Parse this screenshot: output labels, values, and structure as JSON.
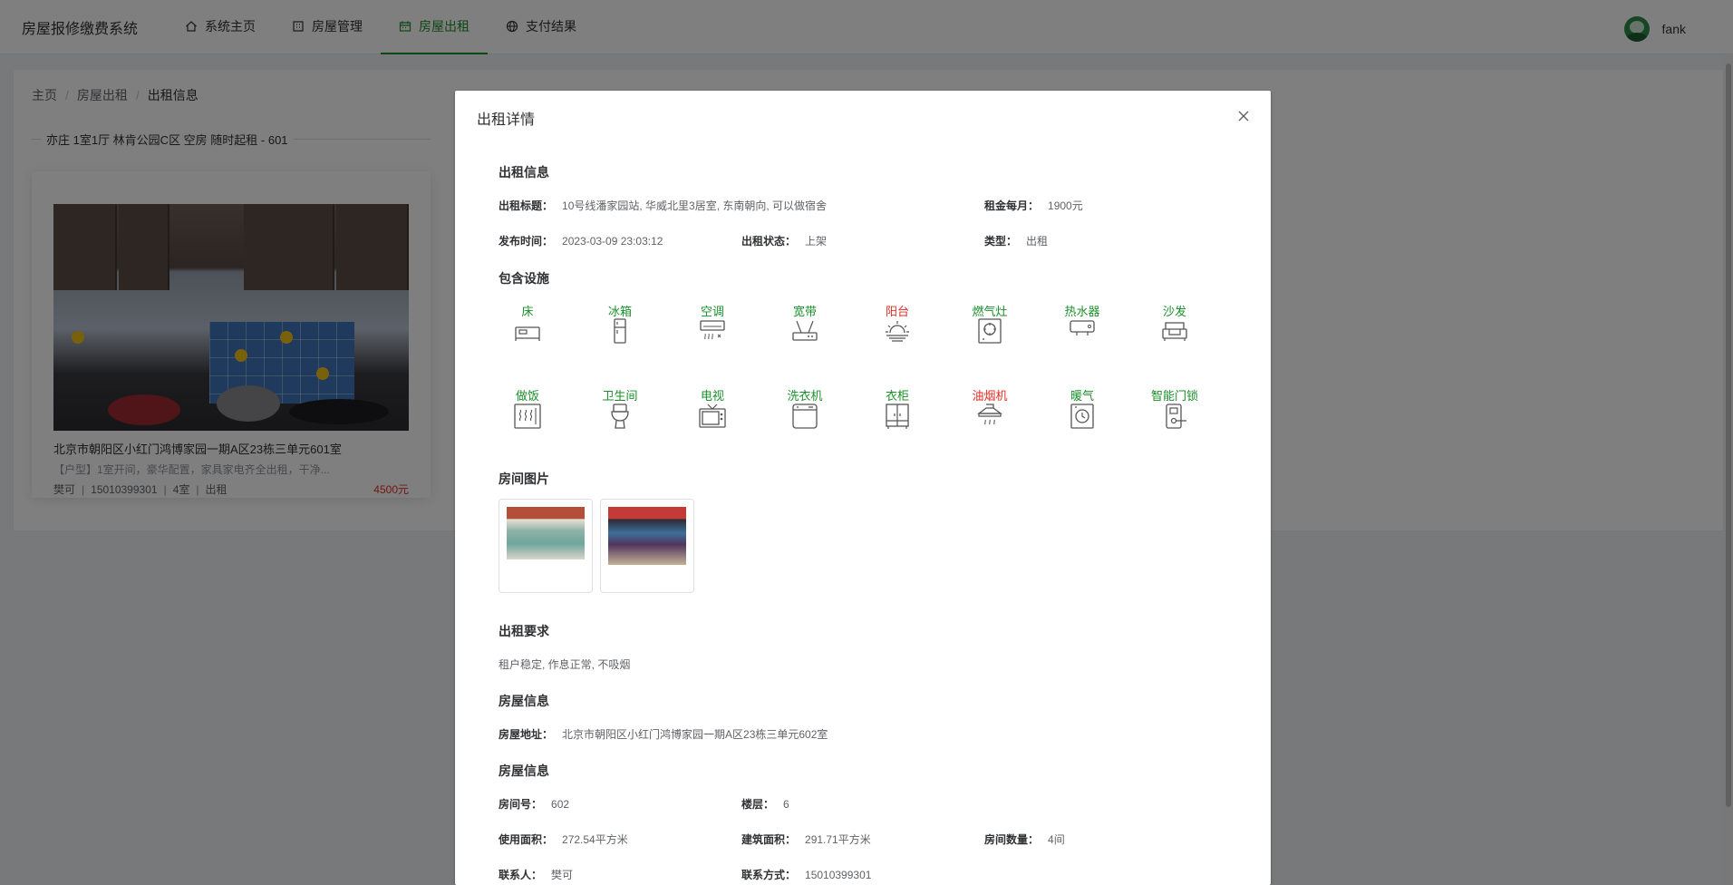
{
  "header": {
    "brand": "房屋报修缴费系统",
    "nav": [
      {
        "label": "系统主页",
        "icon": "home-icon",
        "active": false
      },
      {
        "label": "房屋管理",
        "icon": "building-icon",
        "active": false
      },
      {
        "label": "房屋出租",
        "icon": "calendar-icon",
        "active": true
      },
      {
        "label": "支付结果",
        "icon": "globe-icon",
        "active": false
      }
    ],
    "user": {
      "name": "fank",
      "icon": "avatar"
    },
    "accent_color": "#1a8f2a"
  },
  "breadcrumb": [
    "主页",
    "房屋出租",
    "出租信息"
  ],
  "listing_group": {
    "legend": "亦庄 1室1厅 林肯公园C区 空房 随时起租 - 601"
  },
  "card": {
    "title": "北京市朝阳区小红门鸿博家园一期A区23栋三单元601室",
    "desc": "【户型】1室开间，豪华配置，家具家电齐全出租，干净...",
    "contact": "樊可",
    "phone": "15010399301",
    "rooms": "4室",
    "type": "出租",
    "price": "4500元",
    "price_color": "#e02e24"
  },
  "dialog": {
    "title": "出租详情",
    "close_icon": "close-icon",
    "rental_info": {
      "section": "出租信息",
      "title_label": "出租标题：",
      "title_value": "10号线潘家园站, 华威北里3居室, 东南朝向, 可以做宿舍",
      "rent_label": "租金每月：",
      "rent_value": "1900元",
      "time_label": "发布时间：",
      "time_value": "2023-03-09 23:03:12",
      "status_label": "出租状态：",
      "status_value": "上架",
      "type_label": "类型：",
      "type_value": "出租"
    },
    "facilities": {
      "section": "包含设施",
      "items": [
        {
          "label": "床",
          "icon": "bed-icon",
          "included": true
        },
        {
          "label": "冰箱",
          "icon": "fridge-icon",
          "included": true
        },
        {
          "label": "空调",
          "icon": "air-conditioner-icon",
          "included": true
        },
        {
          "label": "宽带",
          "icon": "router-icon",
          "included": true
        },
        {
          "label": "阳台",
          "icon": "sunrise-icon",
          "included": false
        },
        {
          "label": "燃气灶",
          "icon": "gas-stove-icon",
          "included": true
        },
        {
          "label": "热水器",
          "icon": "water-heater-icon",
          "included": true
        },
        {
          "label": "沙发",
          "icon": "sofa-icon",
          "included": true
        },
        {
          "label": "做饭",
          "icon": "cooker-icon",
          "included": true
        },
        {
          "label": "卫生间",
          "icon": "toilet-icon",
          "included": true
        },
        {
          "label": "电视",
          "icon": "tv-icon",
          "included": true
        },
        {
          "label": "洗衣机",
          "icon": "washing-machine-icon",
          "included": true
        },
        {
          "label": "衣柜",
          "icon": "wardrobe-icon",
          "included": true
        },
        {
          "label": "油烟机",
          "icon": "range-hood-icon",
          "included": false
        },
        {
          "label": "暖气",
          "icon": "heater-icon",
          "included": true
        },
        {
          "label": "智能门锁",
          "icon": "smart-lock-icon",
          "included": true
        }
      ],
      "included_color": "#1a8f2a",
      "excluded_color": "#e02e24"
    },
    "room_images": {
      "section": "房间图片"
    },
    "requirements": {
      "section": "出租要求",
      "text": "租户稳定, 作息正常, 不吸烟"
    },
    "house_address": {
      "section": "房屋信息",
      "label": "房屋地址：",
      "value": "北京市朝阳区小红门鸿博家园一期A区23栋三单元602室"
    },
    "house_info": {
      "section": "房屋信息",
      "room_no_label": "房间号：",
      "room_no": "602",
      "floor_label": "楼层：",
      "floor": "6",
      "usable_area_label": "使用面积：",
      "usable_area": "272.54平方米",
      "building_area_label": "建筑面积：",
      "building_area": "291.71平方米",
      "room_count_label": "房间数量：",
      "room_count": "4间",
      "contact_label": "联系人：",
      "contact": "樊可",
      "phone_label": "联系方式：",
      "phone": "15010399301"
    }
  }
}
